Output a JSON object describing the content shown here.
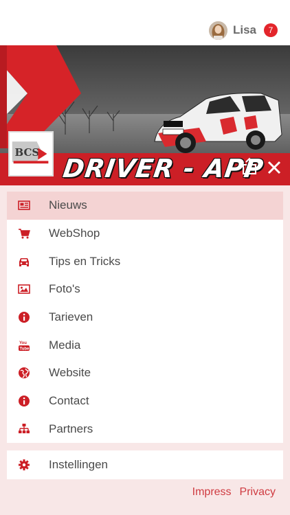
{
  "header": {
    "user_name": "Lisa",
    "notification_count": "7"
  },
  "hero": {
    "banner_title": "DRIVER - APP",
    "logo_name": "BCS-A logo"
  },
  "menu": {
    "items": [
      {
        "label": "Nieuws",
        "icon": "newspaper-icon",
        "active": true
      },
      {
        "label": "WebShop",
        "icon": "cart-icon"
      },
      {
        "label": "Tips en Tricks",
        "icon": "car-icon"
      },
      {
        "label": "Foto's",
        "icon": "image-icon"
      },
      {
        "label": "Tarieven",
        "icon": "info-icon"
      },
      {
        "label": "Media",
        "icon": "youtube-icon"
      },
      {
        "label": "Website",
        "icon": "globe-icon"
      },
      {
        "label": "Contact",
        "icon": "info-icon"
      },
      {
        "label": "Partners",
        "icon": "sitemap-icon"
      }
    ],
    "settings_label": "Instellingen"
  },
  "footer": {
    "impress": "Impress",
    "privacy": "Privacy"
  },
  "colors": {
    "accent": "#cc1f26",
    "active_bg": "#f4d3d3",
    "background": "#f8e7e7",
    "link": "#cf3a40"
  }
}
